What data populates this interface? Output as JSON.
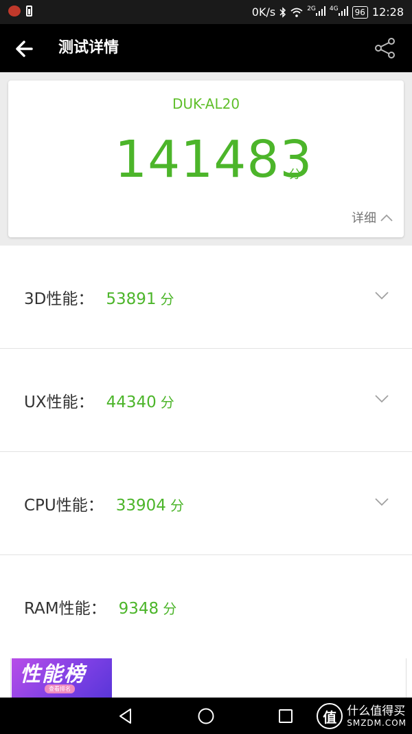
{
  "status_bar": {
    "net_speed": "0K/s",
    "signal_1": "2G",
    "signal_2": "4G",
    "battery": "96",
    "time": "12:28"
  },
  "app_bar": {
    "title": "测试详情",
    "back_icon": "arrow-left-icon",
    "share_icon": "share-icon"
  },
  "score_card": {
    "device": "DUK-AL20",
    "total": "141483",
    "unit": "分",
    "detail_label": "详细"
  },
  "scores": [
    {
      "label": "3D性能：",
      "value": "53891",
      "unit": "分",
      "expandable": true
    },
    {
      "label": "UX性能：",
      "value": "44340",
      "unit": "分",
      "expandable": true
    },
    {
      "label": "CPU性能：",
      "value": "33904",
      "unit": "分",
      "expandable": true
    },
    {
      "label": "RAM性能：",
      "value": "9348",
      "unit": "分",
      "expandable": false
    }
  ],
  "banner": {
    "title": "性能榜",
    "subtitle": "查看排名"
  },
  "watermark": {
    "cn": "什么值得买",
    "en": "SMZDM.COM",
    "logo": "值"
  },
  "colors": {
    "accent": "#4cb52a",
    "app_bar": "#000000",
    "status_bar": "#1a1a1a"
  }
}
